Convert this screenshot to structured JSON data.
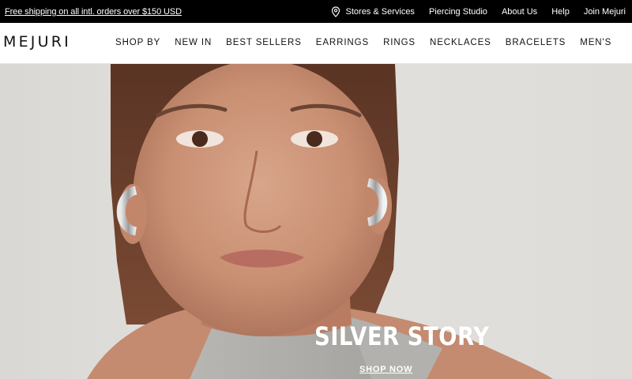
{
  "topbar": {
    "promo": "Free shipping on all intl. orders over $150 USD",
    "links": [
      "Stores & Services",
      "Piercing Studio",
      "About Us",
      "Help",
      "Join Mejuri"
    ],
    "pin_icon": "location-pin-icon"
  },
  "header": {
    "logo": "MEJURI",
    "nav": [
      "SHOP BY",
      "NEW IN",
      "BEST SELLERS",
      "EARRINGS",
      "RINGS",
      "NECKLACES",
      "BRACELETS",
      "MEN'S"
    ]
  },
  "hero": {
    "title": "SILVER STORY",
    "cta": "SHOP NOW"
  },
  "colors": {
    "topbar_bg": "#000000",
    "text_dark": "#111111",
    "hero_bg": "#dfded9",
    "hero_text": "#ffffff"
  }
}
